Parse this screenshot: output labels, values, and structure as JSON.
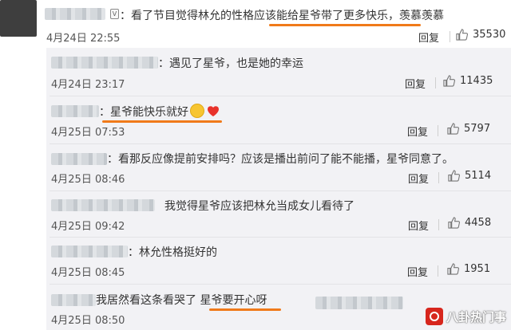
{
  "main_comment": {
    "text_prefix": "：看了节目觉得林允的",
    "text_highlight": "性格应该能给星爷带了更多快乐",
    "text_suffix": "，羡慕羡慕",
    "time": "4月24日 22:55",
    "reply_label": "回复",
    "likes": "35530"
  },
  "replies": [
    {
      "text": "：遇见了星爷，也是她的幸运",
      "time": "4月24日 23:17",
      "reply_label": "回复",
      "likes": "11435"
    },
    {
      "text": "：星爷能快乐就好",
      "time": "4月25日 07:53",
      "reply_label": "回复",
      "likes": "5797"
    },
    {
      "text": "：看那反应像提前安排吗？应该是播出前问了能不能播，星爷同意了。",
      "time": "4月25日 08:46",
      "reply_label": "回复",
      "likes": "5114"
    },
    {
      "text": "我觉得星爷应该把林允当成女儿看待了",
      "time": "4月25日 09:42",
      "reply_label": "回复",
      "likes": "4458"
    },
    {
      "text": "：林允性格挺好的",
      "time": "4月25日 08:45",
      "reply_label": "回复",
      "likes": "1951"
    },
    {
      "text_prefix": "我居然看这条看哭了 ",
      "text_highlight": "星爷要开心呀",
      "time": "4月25日 08:50",
      "reply_label": "回复"
    }
  ],
  "watermark": {
    "text": "八卦热门事"
  },
  "colors": {
    "highlight": "#f07a1a",
    "reply_bg": "#f2f2f5",
    "heart": "#e8322b"
  }
}
